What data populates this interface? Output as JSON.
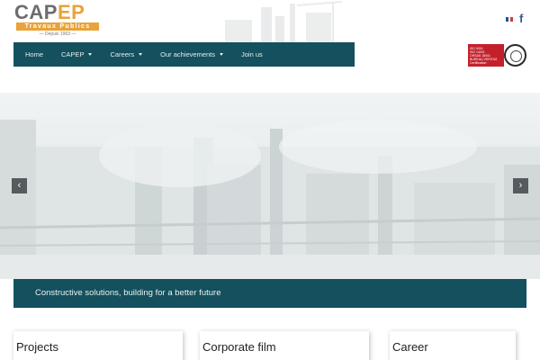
{
  "logo": {
    "brand_main": "CAP",
    "brand_accent": "EP",
    "subtitle": "Travaux Publics",
    "since": "— Depuis 1963 —"
  },
  "header": {
    "language_flag": "french-flag-icon",
    "social": "facebook-icon",
    "social_glyph": "f"
  },
  "nav": {
    "items": [
      {
        "label": "Home",
        "dropdown": false
      },
      {
        "label": "CAPEP",
        "dropdown": true
      },
      {
        "label": "Careers",
        "dropdown": true
      },
      {
        "label": "Our achievements",
        "dropdown": true
      },
      {
        "label": "Join us",
        "dropdown": false
      }
    ]
  },
  "certification": {
    "lines": [
      "ISO 9001",
      "ISO 14001",
      "OHSAS 18001",
      "BUREAU VERITAS",
      "Certification"
    ]
  },
  "slider": {
    "prev_glyph": "‹",
    "next_glyph": "›"
  },
  "banner": {
    "text": "Constructive solutions, building for a better future"
  },
  "cards": [
    {
      "title": "Projects"
    },
    {
      "title": "Corporate film"
    },
    {
      "title": "Career"
    }
  ],
  "colors": {
    "primary": "#14505d",
    "accent": "#e8a33a",
    "facebook": "#3b5998",
    "cert_red": "#c4202b"
  }
}
